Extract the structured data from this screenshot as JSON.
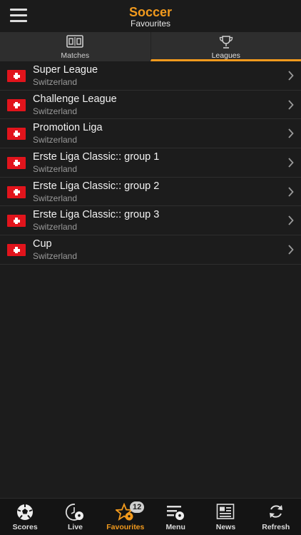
{
  "header": {
    "title": "Soccer",
    "subtitle": "Favourites",
    "menu_icon": "hamburger-icon"
  },
  "tabs": [
    {
      "label": "Matches",
      "icon": "scoreboard-icon",
      "active": false
    },
    {
      "label": "Leagues",
      "icon": "trophy-icon",
      "active": true
    }
  ],
  "leagues": [
    {
      "name": "Super League",
      "country": "Switzerland"
    },
    {
      "name": "Challenge League",
      "country": "Switzerland"
    },
    {
      "name": "Promotion Liga",
      "country": "Switzerland"
    },
    {
      "name": "Erste Liga Classic:: group 1",
      "country": "Switzerland"
    },
    {
      "name": "Erste Liga Classic:: group 2",
      "country": "Switzerland"
    },
    {
      "name": "Erste Liga Classic:: group 3",
      "country": "Switzerland"
    },
    {
      "name": "Cup",
      "country": "Switzerland"
    }
  ],
  "bottom_nav": {
    "items": [
      {
        "label": "Scores",
        "icon": "soccer-ball-icon"
      },
      {
        "label": "Live",
        "icon": "live-clock-ball-icon"
      },
      {
        "label": "Favourites",
        "icon": "star-ball-icon",
        "active": true
      },
      {
        "label": "Menu",
        "icon": "menu-ball-icon"
      },
      {
        "label": "News",
        "icon": "newspaper-icon"
      },
      {
        "label": "Refresh",
        "icon": "refresh-icon"
      }
    ],
    "favourites_badge": "12"
  },
  "colors": {
    "accent": "#f29a1d",
    "background": "#1c1c1c",
    "tab_bar": "#2e2e2e",
    "flag_red": "#e1141c"
  }
}
